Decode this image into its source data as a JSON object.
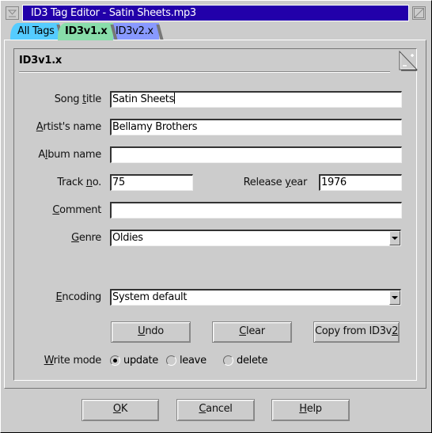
{
  "window": {
    "title": "ID3 Tag Editor - Satin Sheets.mp3",
    "menu_icon": "window-menu-icon",
    "maximize_icon": "maximize-icon"
  },
  "tabs": [
    {
      "label": "All Tags",
      "active": false,
      "color": "#55ccff"
    },
    {
      "label": "ID3v1.x",
      "active": true,
      "color": "#88ddaa"
    },
    {
      "label": "ID3v2.x",
      "active": false,
      "color": "#8899ff"
    }
  ],
  "panel": {
    "title": "ID3v1.x",
    "corner_icon": "zoom-corner-icon"
  },
  "form": {
    "song_title": {
      "label_pre": "Song ",
      "label_ul": "t",
      "label_post": "itle",
      "value": "Satin Sheets"
    },
    "artist": {
      "label_pre": "",
      "label_ul": "A",
      "label_post": "rtist's name",
      "value": "Bellamy Brothers"
    },
    "album": {
      "label_pre": "A",
      "label_ul": "l",
      "label_post": "bum name",
      "value": ""
    },
    "track": {
      "label_pre": "Track ",
      "label_ul": "n",
      "label_post": "o.",
      "value": "75"
    },
    "year": {
      "label_pre": "Release ",
      "label_ul": "y",
      "label_post": "ear",
      "value": "1976"
    },
    "comment": {
      "label_pre": "",
      "label_ul": "C",
      "label_post": "omment",
      "value": ""
    },
    "genre": {
      "label_pre": "",
      "label_ul": "G",
      "label_post": "enre",
      "value": "Oldies"
    },
    "encoding": {
      "label_pre": "",
      "label_ul": "E",
      "label_post": "ncoding",
      "value": "System default"
    }
  },
  "actions": {
    "undo": {
      "pre": "",
      "ul": "U",
      "post": "ndo"
    },
    "clear": {
      "pre": "",
      "ul": "C",
      "post": "lear"
    },
    "copy": {
      "pre": "Copy from ID3v",
      "ul": "2",
      "post": ""
    }
  },
  "write_mode": {
    "label_pre": "",
    "label_ul": "W",
    "label_post": "rite mode",
    "options": [
      {
        "label": "update",
        "selected": true
      },
      {
        "label": "leave",
        "selected": false
      },
      {
        "label": "delete",
        "selected": false
      }
    ]
  },
  "footer": {
    "ok": {
      "pre": "",
      "ul": "O",
      "post": "K"
    },
    "cancel": {
      "pre": "",
      "ul": "C",
      "post": "ancel"
    },
    "help": {
      "pre": "",
      "ul": "H",
      "post": "elp"
    }
  }
}
